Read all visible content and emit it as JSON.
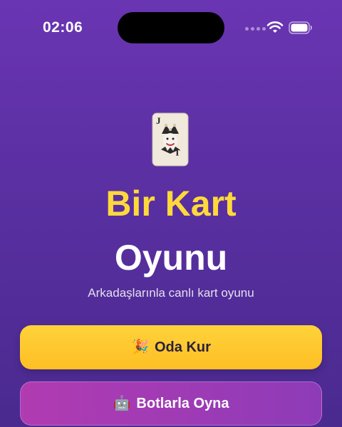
{
  "status_bar": {
    "time": "02:06",
    "icons": [
      "cellular-signal-icon",
      "wifi-icon",
      "battery-icon"
    ]
  },
  "hero": {
    "icon": "joker-card-icon",
    "title_line1": "Bir Kart",
    "title_line2": "Oyunu",
    "subtitle": "Arkadaşlarınla canlı kart oyunu"
  },
  "actions": {
    "create_room": {
      "emoji": "🎉",
      "label": "Oda Kur"
    },
    "play_bots": {
      "emoji": "🤖",
      "label": "Botlarla Oyna"
    }
  },
  "colors": {
    "background_top": "#6a35b3",
    "background_bottom": "#4a2a8f",
    "title_accent": "#ffd93b",
    "primary_button": "#fdbf24",
    "secondary_button": "#a63bb5"
  }
}
